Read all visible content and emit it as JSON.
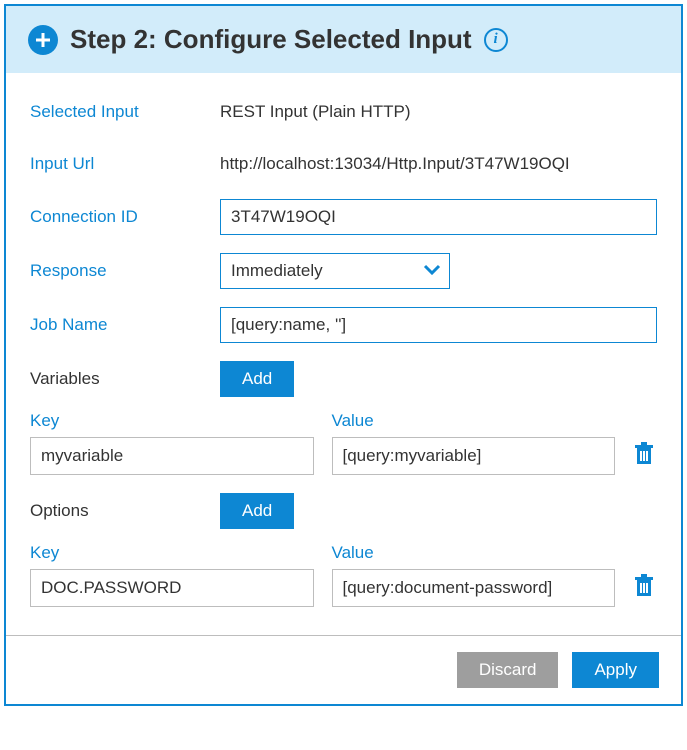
{
  "header": {
    "title": "Step 2: Configure Selected Input"
  },
  "fields": {
    "selected_input": {
      "label": "Selected Input",
      "value": "REST Input (Plain HTTP)"
    },
    "input_url": {
      "label": "Input Url",
      "value": "http://localhost:13034/Http.Input/3T47W19OQI"
    },
    "connection_id": {
      "label": "Connection ID",
      "value": "3T47W19OQI"
    },
    "response": {
      "label": "Response",
      "value": "Immediately"
    },
    "job_name": {
      "label": "Job Name",
      "value": "[query:name, '']"
    }
  },
  "variables": {
    "section_label": "Variables",
    "add_button": "Add",
    "key_label": "Key",
    "value_label": "Value",
    "items": [
      {
        "key": "myvariable",
        "value": "[query:myvariable]"
      }
    ]
  },
  "options": {
    "section_label": "Options",
    "add_button": "Add",
    "key_label": "Key",
    "value_label": "Value",
    "items": [
      {
        "key": "DOC.PASSWORD",
        "value": "[query:document-password]"
      }
    ]
  },
  "footer": {
    "discard": "Discard",
    "apply": "Apply"
  }
}
